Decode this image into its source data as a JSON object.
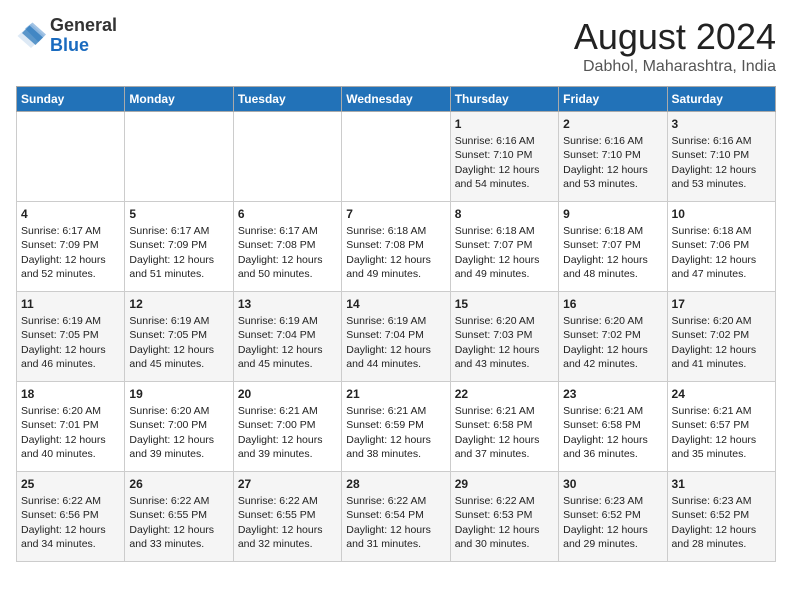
{
  "header": {
    "logo_general": "General",
    "logo_blue": "Blue",
    "month_title": "August 2024",
    "location": "Dabhol, Maharashtra, India"
  },
  "days_of_week": [
    "Sunday",
    "Monday",
    "Tuesday",
    "Wednesday",
    "Thursday",
    "Friday",
    "Saturday"
  ],
  "weeks": [
    [
      {
        "day": "",
        "sunrise": "",
        "sunset": "",
        "daylight": ""
      },
      {
        "day": "",
        "sunrise": "",
        "sunset": "",
        "daylight": ""
      },
      {
        "day": "",
        "sunrise": "",
        "sunset": "",
        "daylight": ""
      },
      {
        "day": "",
        "sunrise": "",
        "sunset": "",
        "daylight": ""
      },
      {
        "day": "1",
        "sunrise": "Sunrise: 6:16 AM",
        "sunset": "Sunset: 7:10 PM",
        "daylight": "Daylight: 12 hours and 54 minutes."
      },
      {
        "day": "2",
        "sunrise": "Sunrise: 6:16 AM",
        "sunset": "Sunset: 7:10 PM",
        "daylight": "Daylight: 12 hours and 53 minutes."
      },
      {
        "day": "3",
        "sunrise": "Sunrise: 6:16 AM",
        "sunset": "Sunset: 7:10 PM",
        "daylight": "Daylight: 12 hours and 53 minutes."
      }
    ],
    [
      {
        "day": "4",
        "sunrise": "Sunrise: 6:17 AM",
        "sunset": "Sunset: 7:09 PM",
        "daylight": "Daylight: 12 hours and 52 minutes."
      },
      {
        "day": "5",
        "sunrise": "Sunrise: 6:17 AM",
        "sunset": "Sunset: 7:09 PM",
        "daylight": "Daylight: 12 hours and 51 minutes."
      },
      {
        "day": "6",
        "sunrise": "Sunrise: 6:17 AM",
        "sunset": "Sunset: 7:08 PM",
        "daylight": "Daylight: 12 hours and 50 minutes."
      },
      {
        "day": "7",
        "sunrise": "Sunrise: 6:18 AM",
        "sunset": "Sunset: 7:08 PM",
        "daylight": "Daylight: 12 hours and 49 minutes."
      },
      {
        "day": "8",
        "sunrise": "Sunrise: 6:18 AM",
        "sunset": "Sunset: 7:07 PM",
        "daylight": "Daylight: 12 hours and 49 minutes."
      },
      {
        "day": "9",
        "sunrise": "Sunrise: 6:18 AM",
        "sunset": "Sunset: 7:07 PM",
        "daylight": "Daylight: 12 hours and 48 minutes."
      },
      {
        "day": "10",
        "sunrise": "Sunrise: 6:18 AM",
        "sunset": "Sunset: 7:06 PM",
        "daylight": "Daylight: 12 hours and 47 minutes."
      }
    ],
    [
      {
        "day": "11",
        "sunrise": "Sunrise: 6:19 AM",
        "sunset": "Sunset: 7:05 PM",
        "daylight": "Daylight: 12 hours and 46 minutes."
      },
      {
        "day": "12",
        "sunrise": "Sunrise: 6:19 AM",
        "sunset": "Sunset: 7:05 PM",
        "daylight": "Daylight: 12 hours and 45 minutes."
      },
      {
        "day": "13",
        "sunrise": "Sunrise: 6:19 AM",
        "sunset": "Sunset: 7:04 PM",
        "daylight": "Daylight: 12 hours and 45 minutes."
      },
      {
        "day": "14",
        "sunrise": "Sunrise: 6:19 AM",
        "sunset": "Sunset: 7:04 PM",
        "daylight": "Daylight: 12 hours and 44 minutes."
      },
      {
        "day": "15",
        "sunrise": "Sunrise: 6:20 AM",
        "sunset": "Sunset: 7:03 PM",
        "daylight": "Daylight: 12 hours and 43 minutes."
      },
      {
        "day": "16",
        "sunrise": "Sunrise: 6:20 AM",
        "sunset": "Sunset: 7:02 PM",
        "daylight": "Daylight: 12 hours and 42 minutes."
      },
      {
        "day": "17",
        "sunrise": "Sunrise: 6:20 AM",
        "sunset": "Sunset: 7:02 PM",
        "daylight": "Daylight: 12 hours and 41 minutes."
      }
    ],
    [
      {
        "day": "18",
        "sunrise": "Sunrise: 6:20 AM",
        "sunset": "Sunset: 7:01 PM",
        "daylight": "Daylight: 12 hours and 40 minutes."
      },
      {
        "day": "19",
        "sunrise": "Sunrise: 6:20 AM",
        "sunset": "Sunset: 7:00 PM",
        "daylight": "Daylight: 12 hours and 39 minutes."
      },
      {
        "day": "20",
        "sunrise": "Sunrise: 6:21 AM",
        "sunset": "Sunset: 7:00 PM",
        "daylight": "Daylight: 12 hours and 39 minutes."
      },
      {
        "day": "21",
        "sunrise": "Sunrise: 6:21 AM",
        "sunset": "Sunset: 6:59 PM",
        "daylight": "Daylight: 12 hours and 38 minutes."
      },
      {
        "day": "22",
        "sunrise": "Sunrise: 6:21 AM",
        "sunset": "Sunset: 6:58 PM",
        "daylight": "Daylight: 12 hours and 37 minutes."
      },
      {
        "day": "23",
        "sunrise": "Sunrise: 6:21 AM",
        "sunset": "Sunset: 6:58 PM",
        "daylight": "Daylight: 12 hours and 36 minutes."
      },
      {
        "day": "24",
        "sunrise": "Sunrise: 6:21 AM",
        "sunset": "Sunset: 6:57 PM",
        "daylight": "Daylight: 12 hours and 35 minutes."
      }
    ],
    [
      {
        "day": "25",
        "sunrise": "Sunrise: 6:22 AM",
        "sunset": "Sunset: 6:56 PM",
        "daylight": "Daylight: 12 hours and 34 minutes."
      },
      {
        "day": "26",
        "sunrise": "Sunrise: 6:22 AM",
        "sunset": "Sunset: 6:55 PM",
        "daylight": "Daylight: 12 hours and 33 minutes."
      },
      {
        "day": "27",
        "sunrise": "Sunrise: 6:22 AM",
        "sunset": "Sunset: 6:55 PM",
        "daylight": "Daylight: 12 hours and 32 minutes."
      },
      {
        "day": "28",
        "sunrise": "Sunrise: 6:22 AM",
        "sunset": "Sunset: 6:54 PM",
        "daylight": "Daylight: 12 hours and 31 minutes."
      },
      {
        "day": "29",
        "sunrise": "Sunrise: 6:22 AM",
        "sunset": "Sunset: 6:53 PM",
        "daylight": "Daylight: 12 hours and 30 minutes."
      },
      {
        "day": "30",
        "sunrise": "Sunrise: 6:23 AM",
        "sunset": "Sunset: 6:52 PM",
        "daylight": "Daylight: 12 hours and 29 minutes."
      },
      {
        "day": "31",
        "sunrise": "Sunrise: 6:23 AM",
        "sunset": "Sunset: 6:52 PM",
        "daylight": "Daylight: 12 hours and 28 minutes."
      }
    ]
  ]
}
